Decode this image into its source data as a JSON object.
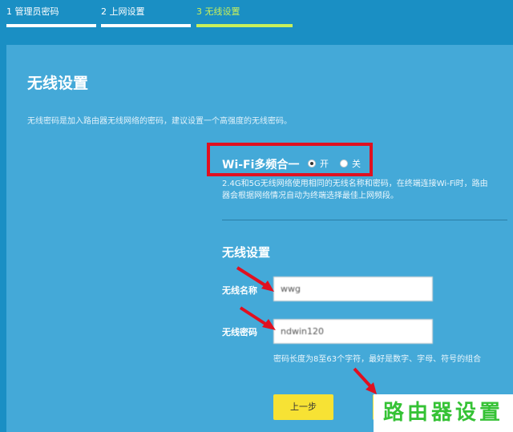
{
  "steps": [
    {
      "label": "1 管理员密码"
    },
    {
      "label": "2 上网设置"
    },
    {
      "label": "3 无线设置"
    }
  ],
  "panel": {
    "title": "无线设置",
    "description": "无线密码是加入路由器无线网络的密码，建议设置一个高强度的无线密码。"
  },
  "wifi_multiband": {
    "label": "Wi-Fi多频合一",
    "options": [
      "开",
      "关"
    ],
    "selected": "开",
    "note": "2.4G和5G无线网络使用相同的无线名称和密码，在终端连接Wi-Fi时，路由器会根据网络情况自动为终端选择最佳上网频段。"
  },
  "wireless": {
    "subtitle": "无线设置",
    "name_label": "无线名称",
    "name_value": "wwg",
    "password_label": "无线密码",
    "password_value": "ndwin120",
    "hint": "密码长度为8至63个字符，最好是数字、字母、符号的组合"
  },
  "buttons": {
    "prev": "上一步"
  },
  "watermark": "路由器设置",
  "colors": {
    "background": "#1a8fc4",
    "panel": "#44a9d8",
    "accent_step": "#c8f05a",
    "highlight_box": "#e01020",
    "button": "#f7e234",
    "watermark_text": "#35c235"
  }
}
